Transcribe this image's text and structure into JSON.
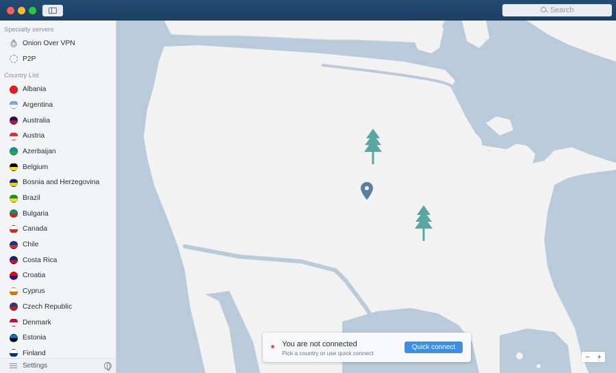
{
  "search": {
    "placeholder": "Search"
  },
  "sidebar": {
    "specialty_header": "Specialty servers",
    "specialty": [
      {
        "label": "Onion Over VPN",
        "icon": "onion-icon"
      },
      {
        "label": "P2P",
        "icon": "p2p-icon"
      }
    ],
    "country_header": "Country List",
    "countries": [
      {
        "label": "Albania",
        "flag": [
          "#e41e20",
          "#e41e20"
        ]
      },
      {
        "label": "Argentina",
        "flag": [
          "#74acdf",
          "#ffffff"
        ]
      },
      {
        "label": "Australia",
        "flag": [
          "#012169",
          "#c8102e"
        ]
      },
      {
        "label": "Austria",
        "flag": [
          "#ed2939",
          "#ffffff"
        ]
      },
      {
        "label": "Azerbaijan",
        "flag": [
          "#0092bc",
          "#3f9c35"
        ]
      },
      {
        "label": "Belgium",
        "flag": [
          "#000000",
          "#fdda24"
        ]
      },
      {
        "label": "Bosnia and Herzegovina",
        "flag": [
          "#002395",
          "#fecb00"
        ]
      },
      {
        "label": "Brazil",
        "flag": [
          "#009c3b",
          "#ffdf00"
        ]
      },
      {
        "label": "Bulgaria",
        "flag": [
          "#00966e",
          "#d62612"
        ]
      },
      {
        "label": "Canada",
        "flag": [
          "#ffffff",
          "#d52b1e"
        ]
      },
      {
        "label": "Chile",
        "flag": [
          "#0039a6",
          "#d52b1e"
        ]
      },
      {
        "label": "Costa Rica",
        "flag": [
          "#002b7f",
          "#ce1126"
        ]
      },
      {
        "label": "Croatia",
        "flag": [
          "#ff0000",
          "#171796"
        ]
      },
      {
        "label": "Cyprus",
        "flag": [
          "#ffffff",
          "#d57800"
        ]
      },
      {
        "label": "Czech Republic",
        "flag": [
          "#11457e",
          "#d7141a"
        ]
      },
      {
        "label": "Denmark",
        "flag": [
          "#c8102e",
          "#ffffff"
        ]
      },
      {
        "label": "Estonia",
        "flag": [
          "#0072ce",
          "#000000"
        ]
      },
      {
        "label": "Finland",
        "flag": [
          "#ffffff",
          "#003580"
        ]
      }
    ],
    "settings_label": "Settings"
  },
  "status": {
    "title": "You are not connected",
    "subtitle": "Pick a country or use quick connect",
    "button": "Quick connect"
  },
  "zoom": {
    "minus": "−",
    "plus": "+"
  },
  "colors": {
    "titlebar": "#1e4266",
    "accent": "#3d8fe6",
    "land": "#f2f2f3",
    "water": "#b9cbda",
    "tree": "#5aa6a1",
    "pin": "#5b7f9e"
  }
}
